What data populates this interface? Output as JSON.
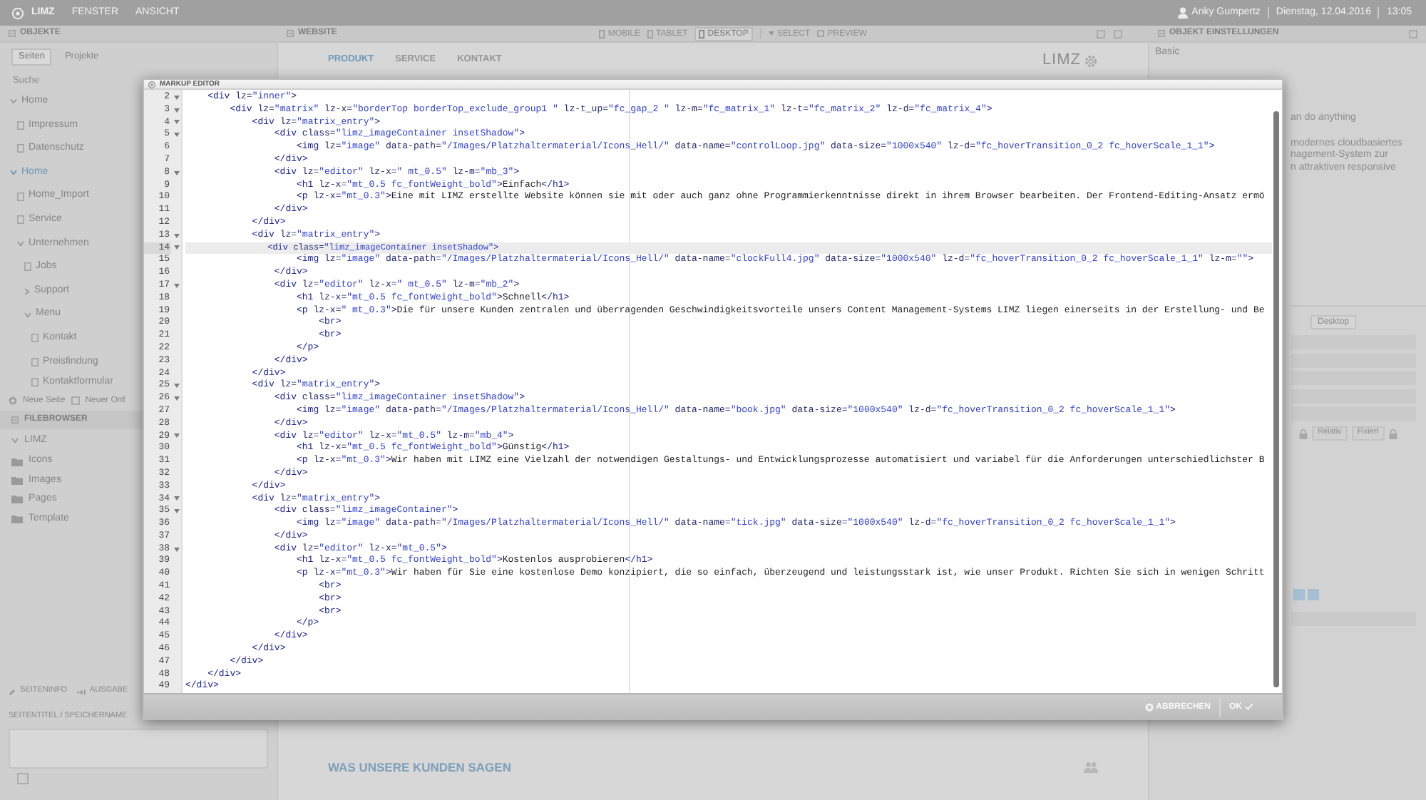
{
  "top_bar": {
    "logo": "LIMZ",
    "menus": [
      "FENSTER",
      "ANSICHT"
    ],
    "user": "Anky Gumpertz",
    "date": "Dienstag, 12.04.2016",
    "time": "13:05"
  },
  "objects_panel": {
    "title": "OBJEKTE",
    "tabs": [
      {
        "label": "Seiten",
        "selected": true
      },
      {
        "label": "Projekte",
        "selected": false
      }
    ],
    "search": {
      "placeholder": "Suche"
    },
    "tree": [
      {
        "label": "Home",
        "kind": "folder",
        "expanded": true,
        "selected": false,
        "children": [
          {
            "label": "Impressum",
            "kind": "page",
            "selected": false
          },
          {
            "label": "Datenschutz",
            "kind": "page",
            "selected": false
          }
        ]
      },
      {
        "label": "Home",
        "kind": "folder",
        "expanded": true,
        "selected": true,
        "children": [
          {
            "label": "Home_Import",
            "kind": "page",
            "selected": false
          },
          {
            "label": "Service",
            "kind": "page",
            "selected": false
          },
          {
            "label": "Unternehmen",
            "kind": "folder",
            "expanded": true,
            "selected": false,
            "children": [
              {
                "label": "Jobs",
                "kind": "page",
                "selected": false
              },
              {
                "label": "Support",
                "kind": "folder",
                "expanded": false,
                "selected": false
              },
              {
                "label": "Menu",
                "kind": "folder",
                "expanded": true,
                "selected": false,
                "children": [
                  {
                    "label": "Kontakt",
                    "kind": "page",
                    "selected": false
                  },
                  {
                    "label": "Preisfindung",
                    "kind": "page",
                    "selected": false
                  },
                  {
                    "label": "Kontaktformular",
                    "kind": "page",
                    "selected": false
                  }
                ]
              }
            ]
          }
        ]
      }
    ],
    "actions": [
      {
        "kind": "new_page",
        "label": "Neue Seite"
      },
      {
        "kind": "new_folder",
        "label": "Neuer Ord"
      }
    ]
  },
  "filebrowser": {
    "title": "FILEBROWSER",
    "root": "LIMZ",
    "folders": [
      "Icons",
      "Images",
      "Pages",
      "Template"
    ]
  },
  "page_settings": {
    "tabs": [
      {
        "kind": "edit",
        "label": "SEITENINFO"
      },
      {
        "kind": "export",
        "label": "AUSGABE"
      }
    ],
    "field_label": "SEITENTITEL / SPEICHERNAME"
  },
  "website_panel": {
    "title": "WEBSITE",
    "views": [
      {
        "label": "MOBILE",
        "selected": false
      },
      {
        "label": "TABLET",
        "selected": false
      },
      {
        "label": "DESKTOP",
        "selected": true
      }
    ],
    "tools": [
      {
        "kind": "select",
        "label": "SELECT"
      },
      {
        "kind": "preview",
        "label": "PREVIEW"
      }
    ],
    "nav": [
      {
        "label": "PRODUKT",
        "selected": true
      },
      {
        "label": "SERVICE",
        "selected": false
      },
      {
        "label": "KONTAKT",
        "selected": false
      }
    ],
    "logo": "LIMZ",
    "section_heading": "WAS UNSERE KUNDEN SAGEN"
  },
  "settings_panel": {
    "title": "OBJEKT EINSTELLUNGEN",
    "group": "Basic",
    "text_lines": [
      "an do anything",
      "modernes cloudbasiertes",
      "nagement-System zur",
      "n attraktiven responsive"
    ],
    "breakpoint": "Desktop",
    "position_options": [
      "Relativ",
      "Fixiert"
    ]
  },
  "markup_editor": {
    "title": "MARKUP EDITOR",
    "lines": [
      {
        "number": "2",
        "foldable": true,
        "selected": false,
        "code": "    <div lz=\"inner\">"
      },
      {
        "number": "3",
        "foldable": true,
        "selected": false,
        "code": "        <div lz=\"matrix\" lz-x=\"borderTop borderTop_exclude_group1 \" lz-t_up=\"fc_gap_2 \" lz-m=\"fc_matrix_1\" lz-t=\"fc_matrix_2\" lz-d=\"fc_matrix_4\">"
      },
      {
        "number": "4",
        "foldable": true,
        "selected": false,
        "code": "            <div lz=\"matrix_entry\">"
      },
      {
        "number": "5",
        "foldable": true,
        "selected": false,
        "code": "                <div class=\"limz_imageContainer insetShadow\">"
      },
      {
        "number": "6",
        "foldable": false,
        "selected": false,
        "code": "                    <img lz=\"image\" data-path=\"/Images/Platzhaltermaterial/Icons_Hell/\" data-name=\"controlLoop.jpg\" data-size=\"1000x540\" lz-d=\"fc_hoverTransition_0_2 fc_hoverScale_1_1\">"
      },
      {
        "number": "7",
        "foldable": false,
        "selected": false,
        "code": "                </div>"
      },
      {
        "number": "8",
        "foldable": true,
        "selected": false,
        "code": "                <div lz=\"editor\" lz-x=\" mt_0.5\" lz-m=\"mb_3\">"
      },
      {
        "number": "9",
        "foldable": false,
        "selected": false,
        "code": "                    <h1 lz-x=\"mt_0.5 fc_fontWeight_bold\">Einfach</h1>"
      },
      {
        "number": "10",
        "foldable": false,
        "selected": false,
        "code": "                    <p lz-x=\"mt_0.3\">Eine mit LIMZ erstellte Website können sie mit oder auch ganz ohne Programmierkenntnisse direkt in ihrem Browser bearbeiten. Der Frontend-Editing-Ansatz ermö"
      },
      {
        "number": "11",
        "foldable": false,
        "selected": false,
        "code": "                </div>"
      },
      {
        "number": "12",
        "foldable": false,
        "selected": false,
        "code": "            </div>"
      },
      {
        "number": "13",
        "foldable": true,
        "selected": false,
        "code": "            <div lz=\"matrix_entry\">"
      },
      {
        "number": "14",
        "foldable": true,
        "selected": true,
        "code": "                <div class=\"limz_imageContainer insetShadow\">"
      },
      {
        "number": "15",
        "foldable": false,
        "selected": false,
        "code": "                    <img lz=\"image\" data-path=\"/Images/Platzhaltermaterial/Icons_Hell/\" data-name=\"clockFull4.jpg\" data-size=\"1000x540\" lz-d=\"fc_hoverTransition_0_2 fc_hoverScale_1_1\" lz-m=\"\">"
      },
      {
        "number": "16",
        "foldable": false,
        "selected": false,
        "code": "                </div>"
      },
      {
        "number": "17",
        "foldable": true,
        "selected": false,
        "code": "                <div lz=\"editor\" lz-x=\" mt_0.5\" lz-m=\"mb_2\">"
      },
      {
        "number": "18",
        "foldable": false,
        "selected": false,
        "code": "                    <h1 lz-x=\"mt_0.5 fc_fontWeight_bold\">Schnell</h1>"
      },
      {
        "number": "19",
        "foldable": false,
        "selected": false,
        "code": "                    <p lz-x=\" mt_0.3\">Die für unsere Kunden zentralen und überragenden Geschwindigkeitsvorteile unsers Content Management-Systems LIMZ liegen einerseits in der Erstellung- und Be"
      },
      {
        "number": "20",
        "foldable": false,
        "selected": false,
        "code": "                        <br>"
      },
      {
        "number": "21",
        "foldable": false,
        "selected": false,
        "code": "                        <br>"
      },
      {
        "number": "22",
        "foldable": false,
        "selected": false,
        "code": "                    </p>"
      },
      {
        "number": "23",
        "foldable": false,
        "selected": false,
        "code": "                </div>"
      },
      {
        "number": "24",
        "foldable": false,
        "selected": false,
        "code": "            </div>"
      },
      {
        "number": "25",
        "foldable": true,
        "selected": false,
        "code": "            <div lz=\"matrix_entry\">"
      },
      {
        "number": "26",
        "foldable": true,
        "selected": false,
        "code": "                <div class=\"limz_imageContainer insetShadow\">"
      },
      {
        "number": "27",
        "foldable": false,
        "selected": false,
        "code": "                    <img lz=\"image\" data-path=\"/Images/Platzhaltermaterial/Icons_Hell/\" data-name=\"book.jpg\" data-size=\"1000x540\" lz-d=\"fc_hoverTransition_0_2 fc_hoverScale_1_1\">"
      },
      {
        "number": "28",
        "foldable": false,
        "selected": false,
        "code": "                </div>"
      },
      {
        "number": "29",
        "foldable": true,
        "selected": false,
        "code": "                <div lz=\"editor\" lz-x=\"mt_0.5\" lz-m=\"mb_4\">"
      },
      {
        "number": "30",
        "foldable": false,
        "selected": false,
        "code": "                    <h1 lz-x=\"mt_0.5 fc_fontWeight_bold\">Günstig</h1>"
      },
      {
        "number": "31",
        "foldable": false,
        "selected": false,
        "code": "                    <p lz-x=\"mt_0.3\">Wir haben mit LIMZ eine Vielzahl der notwendigen Gestaltungs- und Entwicklungsprozesse automatisiert und variabel für die Anforderungen unterschiedlichster B"
      },
      {
        "number": "32",
        "foldable": false,
        "selected": false,
        "code": "                </div>"
      },
      {
        "number": "33",
        "foldable": false,
        "selected": false,
        "code": "            </div>"
      },
      {
        "number": "34",
        "foldable": true,
        "selected": false,
        "code": "            <div lz=\"matrix_entry\">"
      },
      {
        "number": "35",
        "foldable": true,
        "selected": false,
        "code": "                <div class=\"limz_imageContainer\">"
      },
      {
        "number": "36",
        "foldable": false,
        "selected": false,
        "code": "                    <img lz=\"image\" data-path=\"/Images/Platzhaltermaterial/Icons_Hell/\" data-name=\"tick.jpg\" data-size=\"1000x540\" lz-d=\"fc_hoverTransition_0_2 fc_hoverScale_1_1\">"
      },
      {
        "number": "37",
        "foldable": false,
        "selected": false,
        "code": "                </div>"
      },
      {
        "number": "38",
        "foldable": true,
        "selected": false,
        "code": "                <div lz=\"editor\" lz-x=\"mt_0.5\">"
      },
      {
        "number": "39",
        "foldable": false,
        "selected": false,
        "code": "                    <h1 lz-x=\"mt_0.5 fc_fontWeight_bold\">Kostenlos ausprobieren</h1>"
      },
      {
        "number": "40",
        "foldable": false,
        "selected": false,
        "code": "                    <p lz-x=\"mt_0.3\">Wir haben für Sie eine kostenlose Demo konzipiert, die so einfach, überzeugend und leistungsstark ist, wie unser Produkt. Richten Sie sich in wenigen Schritt"
      },
      {
        "number": "41",
        "foldable": false,
        "selected": false,
        "code": "                        <br>"
      },
      {
        "number": "42",
        "foldable": false,
        "selected": false,
        "code": "                        <br>"
      },
      {
        "number": "43",
        "foldable": false,
        "selected": false,
        "code": "                        <br>"
      },
      {
        "number": "44",
        "foldable": false,
        "selected": false,
        "code": "                    </p>"
      },
      {
        "number": "45",
        "foldable": false,
        "selected": false,
        "code": "                </div>"
      },
      {
        "number": "46",
        "foldable": false,
        "selected": false,
        "code": "            </div>"
      },
      {
        "number": "47",
        "foldable": false,
        "selected": false,
        "code": "        </div>"
      },
      {
        "number": "48",
        "foldable": false,
        "selected": false,
        "code": "    </div>"
      },
      {
        "number": "49",
        "foldable": false,
        "selected": false,
        "code": "</div>"
      }
    ],
    "buttons": [
      {
        "kind": "cancel",
        "label": "ABBRECHEN"
      },
      {
        "kind": "confirm",
        "label": "OK"
      }
    ]
  }
}
